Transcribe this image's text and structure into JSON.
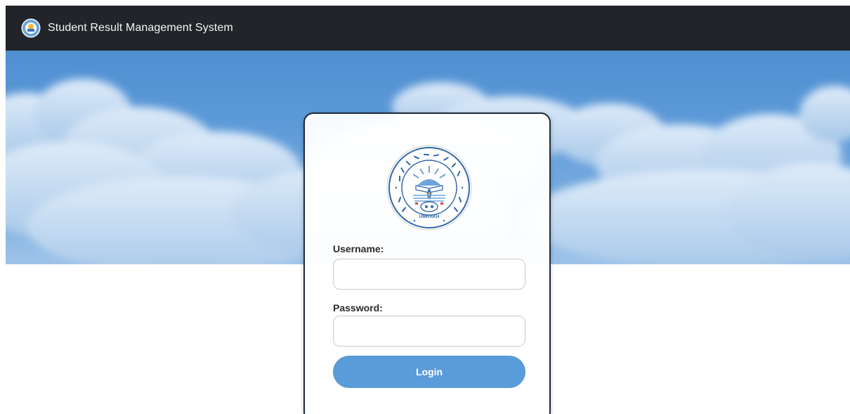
{
  "navbar": {
    "logo_icon": "college-seal-icon",
    "title": "Student Result Management System",
    "background": "#212529"
  },
  "hero": {
    "sky_color": "#5d9ad8"
  },
  "login_card": {
    "logo": {
      "icon": "college-seal-icon",
      "seal_text": "VIDYABHARTI TRUST COLLEGE OF BUSINESS, COMPUTER-SCIENCE AND RESEARCH",
      "seal_bottom_text": "UMRAKH"
    },
    "username": {
      "label": "Username:",
      "value": "",
      "placeholder": ""
    },
    "password": {
      "label": "Password:",
      "value": "",
      "placeholder": ""
    },
    "login_button": {
      "label": "Login",
      "color": "#5a9bd9"
    }
  }
}
